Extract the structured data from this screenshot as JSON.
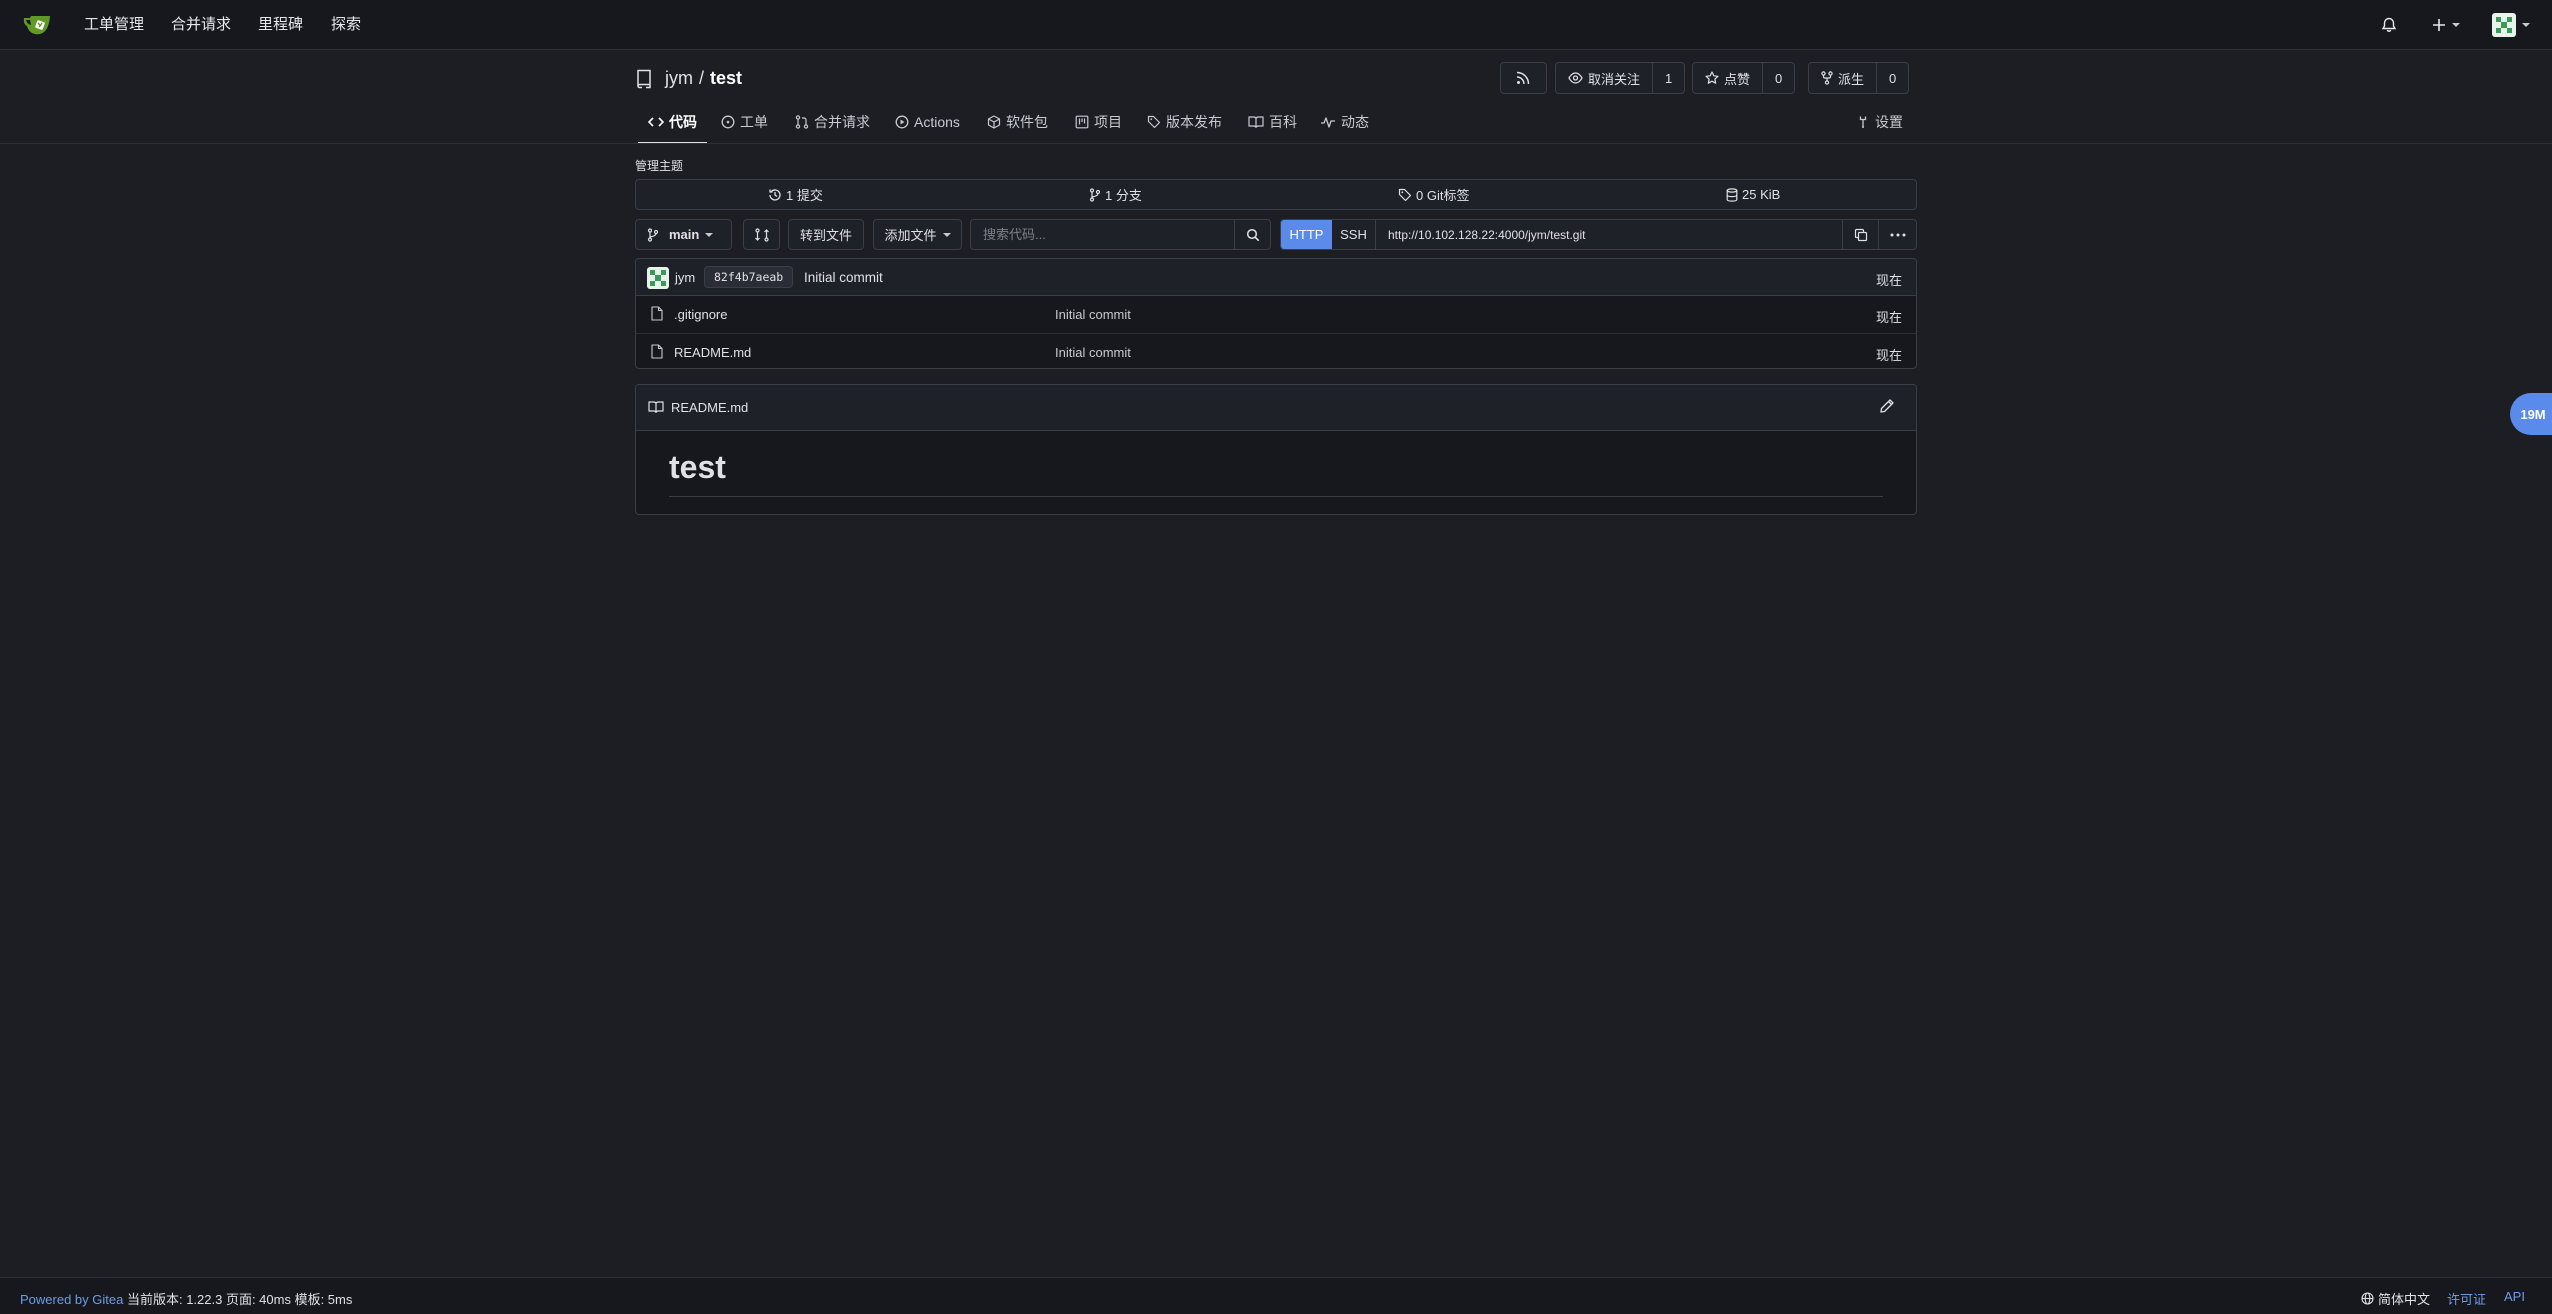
{
  "topnav": {
    "items": [
      "工单管理",
      "合并请求",
      "里程碑",
      "探索"
    ]
  },
  "repo": {
    "owner": "jym",
    "slash": "/",
    "name": "test",
    "watch_label": "取消关注",
    "watch_count": "1",
    "star_label": "点赞",
    "star_count": "0",
    "fork_label": "派生",
    "fork_count": "0"
  },
  "tabs": {
    "code": "代码",
    "issues": "工单",
    "pulls": "合并请求",
    "actions": "Actions",
    "packages": "软件包",
    "projects": "项目",
    "releases": "版本发布",
    "wiki": "百科",
    "activity": "动态",
    "settings": "设置"
  },
  "topics_label": "管理主题",
  "stats": {
    "commits": "1 提交",
    "branches": "1 分支",
    "tags": "0 Git标签",
    "size": "25 KiB"
  },
  "toolbar": {
    "branch": "main",
    "goto_file": "转到文件",
    "add_file": "添加文件",
    "search_placeholder": "搜索代码...",
    "http": "HTTP",
    "ssh": "SSH",
    "clone_url": "http://10.102.128.22:4000/jym/test.git"
  },
  "latest_commit": {
    "author": "jym",
    "sha": "82f4b7aeab",
    "message": "Initial commit",
    "time": "现在"
  },
  "files": [
    {
      "name": ".gitignore",
      "commit": "Initial commit",
      "time": "现在"
    },
    {
      "name": "README.md",
      "commit": "Initial commit",
      "time": "现在"
    }
  ],
  "readme": {
    "filename": "README.md",
    "heading": "test"
  },
  "bubble_label": "19M",
  "footer": {
    "powered": "Powered by Gitea",
    "version_info": "当前版本: 1.22.3 页面: 40ms 模板: 5ms",
    "language": "简体中文",
    "license": "许可证",
    "api": "API"
  },
  "colors": {
    "accent": "#5a8bea",
    "link": "#6c9ce8",
    "background": "#1c1e24"
  }
}
